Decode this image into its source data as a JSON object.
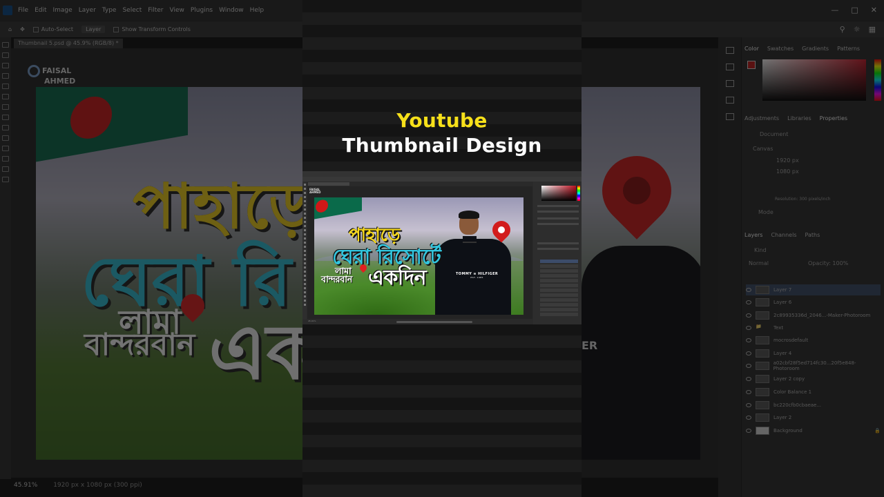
{
  "background": {
    "menu": [
      "File",
      "Edit",
      "Image",
      "Layer",
      "Type",
      "Select",
      "Filter",
      "View",
      "Plugins",
      "Window",
      "Help"
    ],
    "options": {
      "auto_select": "Auto-Select",
      "layer_dropdown": "Layer",
      "show_transform": "Show Transform Controls"
    },
    "document_tab": "Thumbnail 5.psd @ 45.9% (RGB/8) *",
    "logo_line1": "FAISAL",
    "logo_line2": "AHMED",
    "thumb_text": {
      "line1": "পাহাড়ে",
      "line2": "ঘেরা রি",
      "line3": "লামা",
      "line4": "বান্দরবান",
      "line5": "এক",
      "shirt": "ER"
    },
    "status": {
      "zoom": "45.91%",
      "size": "1920 px x 1080 px (300 ppi)"
    },
    "right_panel": {
      "color_tabs": [
        "Color",
        "Swatches",
        "Gradients",
        "Patterns"
      ],
      "prop_tabs": [
        "Adjustments",
        "Libraries",
        "Properties"
      ],
      "document_label": "Document",
      "canvas_label": "Canvas",
      "width": "1920 px",
      "height": "1080 px",
      "resolution": "Resolution: 300 pixels/inch",
      "mode": "Mode",
      "layers_tabs": [
        "Layers",
        "Channels",
        "Paths"
      ],
      "kind": "Kind",
      "blend_mode": "Normal",
      "opacity": "Opacity: 100%",
      "layers": [
        "Layer 7",
        "Layer 6",
        "2c89935336d_2046...-Maker-Photoroom",
        "Text",
        "mocrosdefault",
        "Layer 4",
        "a02cbf28f5ed714fc30...20f5e848-Photoroom",
        "Layer 2 copy",
        "Color Balance 1",
        "bc220cfb0cbaeae...",
        "Layer 2",
        "Background"
      ]
    }
  },
  "overlay": {
    "title_line1": "Youtube",
    "title_line2": "Thumbnail Design",
    "colors": {
      "title_yellow": "#f7e01a",
      "title_white": "#ffffff"
    }
  },
  "mini_thumb": {
    "logo_line1": "FAISAL",
    "logo_line2": "AHMED",
    "line1": "পাহাড়ে",
    "line2": "ঘেরা রিসোর্টে",
    "line3": "লামা",
    "line4": "বান্দরবান",
    "line5": "একদিন",
    "brand": "TOMMY ≡ HILFIGER",
    "brand_sub": "EST. 1985",
    "zoom": "45.91%"
  }
}
